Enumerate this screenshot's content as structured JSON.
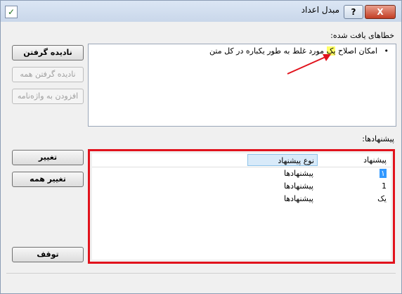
{
  "window": {
    "title": "مبدل اعداد",
    "help_label": "?",
    "close_label": "X"
  },
  "errors": {
    "label": "خطاهای یافت شده:",
    "items": [
      {
        "before": "امکان اصلاح ",
        "highlight": "یک",
        "after": " مورد غلط به طور یکباره در کل متن"
      }
    ]
  },
  "buttons": {
    "ignore": "نادیده گرفتن",
    "ignore_all": "نادیده گرفتن همه",
    "add_dictionary": "افزودن به واژه‌نامه",
    "change": "تغییر",
    "change_all": "تغییر همه",
    "stop": "توقف"
  },
  "suggestions": {
    "label": "پیشنهادها:",
    "columns": [
      "پیشنهاد",
      "نوع پیشنهاد"
    ],
    "rows": [
      {
        "value": "۱",
        "type": "پیشنهادها",
        "selected": true
      },
      {
        "value": "1",
        "type": "پیشنهادها",
        "selected": false
      },
      {
        "value": "یک",
        "type": "پیشنهادها",
        "selected": false
      }
    ]
  }
}
